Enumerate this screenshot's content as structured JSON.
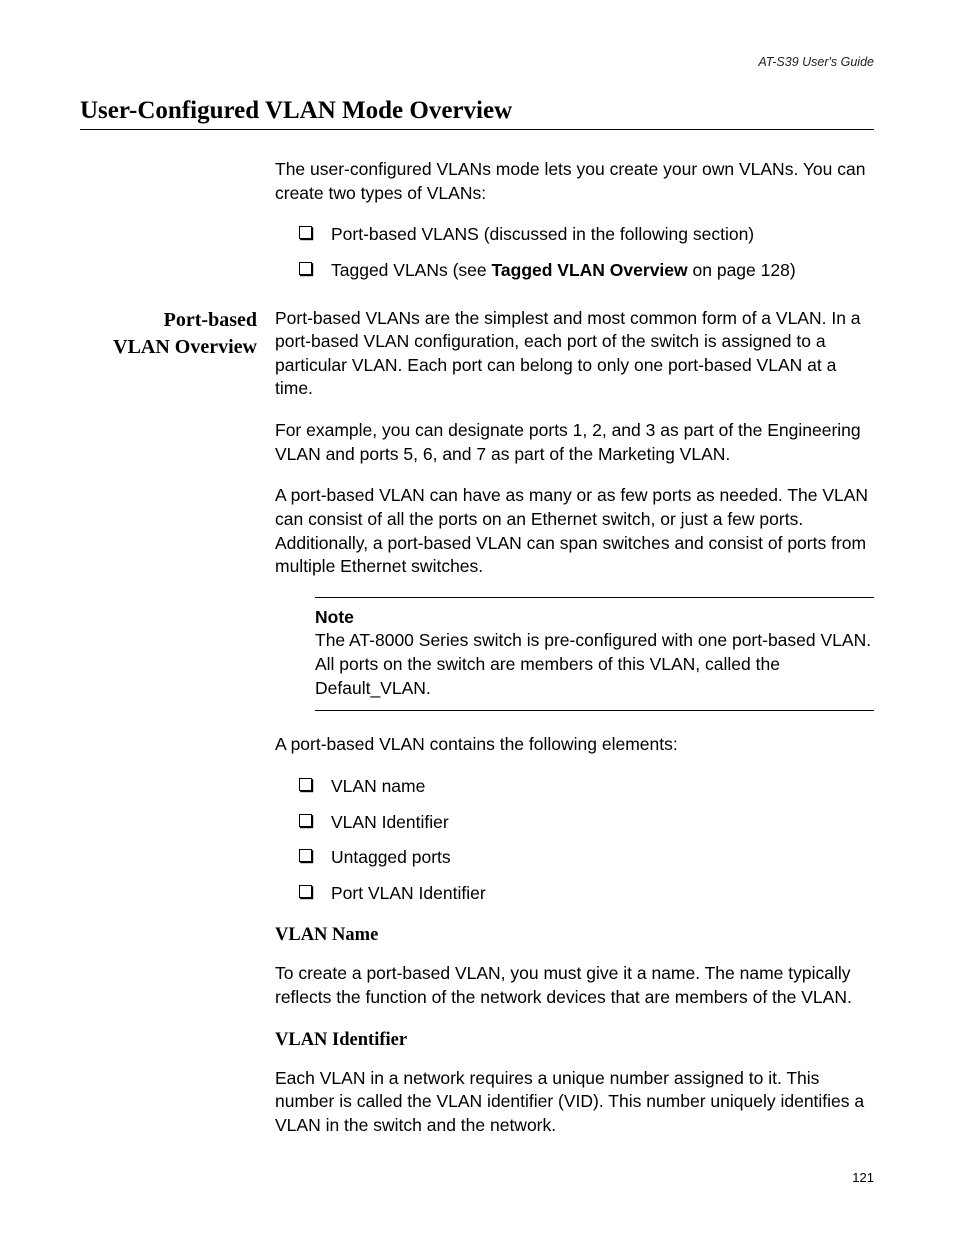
{
  "header": "AT-S39 User's Guide",
  "page_number": "121",
  "title": "User-Configured VLAN Mode Overview",
  "intro_para": "The user-configured VLANs mode lets you create your own VLANs. You can create two types of VLANs:",
  "intro_bullets": {
    "b1": "Port-based VLANS (discussed in the following section)",
    "b2_pre": "Tagged VLANs (see ",
    "b2_bold": "Tagged VLAN Overview",
    "b2_post": " on page 128)"
  },
  "side_heading_line1": "Port-based",
  "side_heading_line2": "VLAN Overview",
  "pb_para1": "Port-based VLANs are the simplest and most common form of a VLAN. In a port-based VLAN configuration, each port of the switch is assigned to a particular VLAN. Each port can belong to only one port-based VLAN at a time.",
  "pb_para2": "For example, you can designate ports 1, 2, and 3 as part of the Engineering VLAN and ports 5, 6, and 7 as part of the Marketing VLAN.",
  "pb_para3": "A port-based VLAN can have as many or as few ports as needed. The VLAN can consist of all the ports on an Ethernet switch, or just a few ports. Additionally, a port-based VLAN can span switches and consist of ports from multiple Ethernet switches.",
  "note_label": "Note",
  "note_body": "The AT-8000 Series switch is pre-configured with one port-based VLAN. All ports on the switch are members of this VLAN, called the Default_VLAN.",
  "pb_para4": "A port-based VLAN contains the following elements:",
  "elements": {
    "e1": "VLAN name",
    "e2": "VLAN Identifier",
    "e3": "Untagged ports",
    "e4": "Port VLAN Identifier"
  },
  "sub1_title": "VLAN Name",
  "sub1_body": "To create a port-based VLAN, you must give it a name. The name typically reflects the function of the network devices that are members of the VLAN.",
  "sub2_title": "VLAN Identifier",
  "sub2_body": "Each VLAN in a network requires a unique number assigned to it. This number is called the VLAN identifier (VID). This number uniquely identifies a VLAN in the switch and the network."
}
